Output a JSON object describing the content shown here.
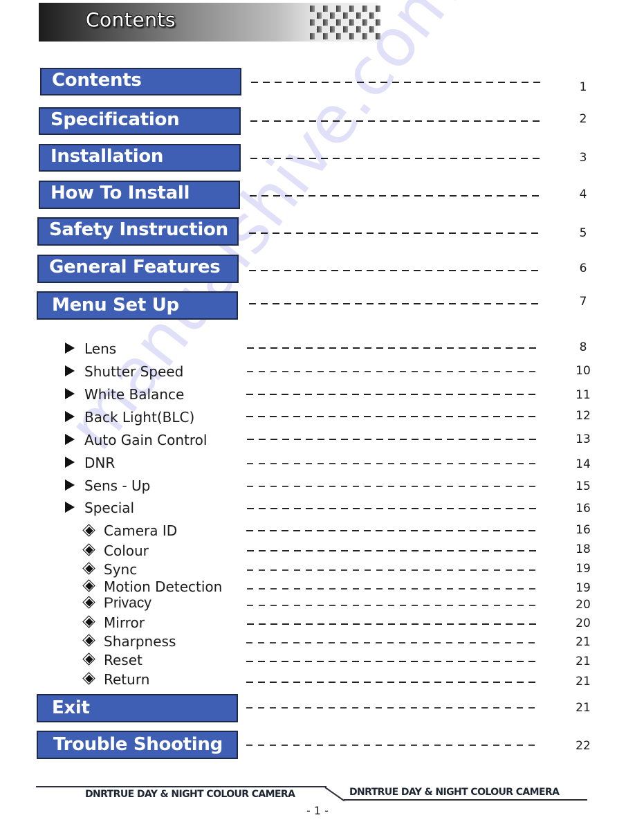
{
  "header": {
    "title": "Contents"
  },
  "main_sections": [
    {
      "label": "Contents",
      "page": "1"
    },
    {
      "label": "Specification",
      "page": "2"
    },
    {
      "label": "Installation",
      "page": "3"
    },
    {
      "label": "How To Install",
      "page": "4"
    },
    {
      "label": "Safety Instruction",
      "page": "5"
    },
    {
      "label": "General Features",
      "page": "6"
    },
    {
      "label": "Menu Set Up",
      "page": "7"
    }
  ],
  "menu_subsections": [
    {
      "label": "Lens",
      "page": "8"
    },
    {
      "label": "Shutter Speed",
      "page": "10"
    },
    {
      "label": "White Balance",
      "page": "11"
    },
    {
      "label": "Back Light(BLC)",
      "page": "12"
    },
    {
      "label": "Auto Gain Control",
      "page": "13"
    },
    {
      "label": "DNR",
      "page": "14"
    },
    {
      "label": "Sens - Up",
      "page": "15"
    },
    {
      "label": "Special",
      "page": "16"
    }
  ],
  "special_subsections": [
    {
      "label": "Camera ID",
      "page": "16"
    },
    {
      "label": "Colour",
      "page": "18"
    },
    {
      "label": "Sync",
      "page": "19"
    },
    {
      "label": "Motion Detection",
      "page": "19"
    },
    {
      "label": "Privacy",
      "page": "20"
    },
    {
      "label": "Mirror",
      "page": "20"
    },
    {
      "label": "Sharpness",
      "page": "21"
    },
    {
      "label": "Reset",
      "page": "21"
    },
    {
      "label": "Return",
      "page": "21"
    }
  ],
  "trailing_sections": [
    {
      "label": "Exit",
      "page": "21"
    },
    {
      "label": "Trouble Shooting",
      "page": "22"
    }
  ],
  "footer": {
    "left_text": "DNRTRUE DAY & NIGHT COLOUR CAMERA",
    "right_text": "DNRTRUE DAY & NIGHT COLOUR CAMERA",
    "page_number": "- 1 -"
  },
  "watermark": {
    "text": "manualshive.com"
  },
  "colors": {
    "section_box": "#3e5fb4",
    "section_border": "#1f2a4a",
    "watermark": "#c9c8f5"
  }
}
